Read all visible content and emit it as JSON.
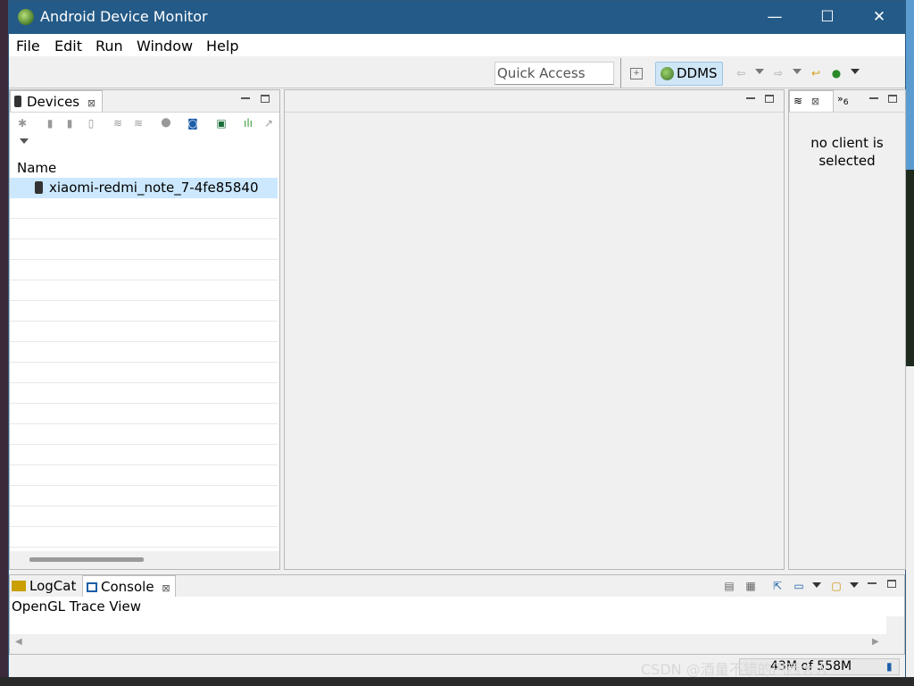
{
  "window": {
    "title": "Android Device Monitor",
    "minimize_label": "—",
    "maximize_label": "☐",
    "close_label": "✕"
  },
  "menubar": {
    "items": [
      {
        "label": "File",
        "mnemonic": "F"
      },
      {
        "label": "Edit",
        "mnemonic": "E"
      },
      {
        "label": "Run",
        "mnemonic": "R"
      },
      {
        "label": "Window",
        "mnemonic": "W"
      },
      {
        "label": "Help",
        "mnemonic": "H"
      }
    ]
  },
  "toolbar": {
    "quick_access_placeholder": "Quick Access",
    "perspective_label": "DDMS"
  },
  "devices_panel": {
    "tab_label": "Devices",
    "column_header": "Name",
    "rows": [
      "xiaomi-redmi_note_7-4fe85840"
    ]
  },
  "right_panel": {
    "tab_overflow_count": "6",
    "message": "no client is selected"
  },
  "bottom_panel": {
    "tabs": [
      "LogCat",
      "Console"
    ],
    "console_title": "OpenGL Trace View"
  },
  "status": {
    "memory": "43M of 558M"
  },
  "watermark": {
    "text": "CSDN @酒量不错的巴西大人"
  },
  "colors": {
    "titlebar": "#245a87",
    "selection": "#cce8ff",
    "ddms_active": "#cfe6f7"
  }
}
